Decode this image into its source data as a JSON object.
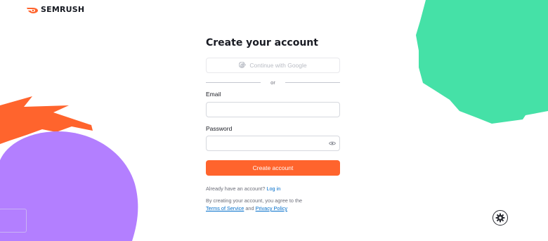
{
  "brand": {
    "name": "SEMRUSH",
    "logo_icon": "semrush-flame-icon",
    "color": "#ff642d"
  },
  "form": {
    "title": "Create your account",
    "google_button": "Continue with Google",
    "divider_text": "or",
    "email_label": "Email",
    "email_value": "",
    "password_label": "Password",
    "password_value": "",
    "password_toggle_icon": "eye-icon",
    "submit_label": "Create account",
    "login_prompt": "Already have an account?",
    "login_link": "Log in",
    "terms_prefix": "By creating your account, you agree to the",
    "terms_link": "Terms of Service",
    "terms_and": "and",
    "privacy_link": "Privacy Policy"
  },
  "settings_icon": "gear-icon",
  "colors": {
    "accent": "#ff642d",
    "link": "#006dca",
    "green": "#45e1a7",
    "purple": "#b37fff",
    "orange": "#ff642d"
  }
}
